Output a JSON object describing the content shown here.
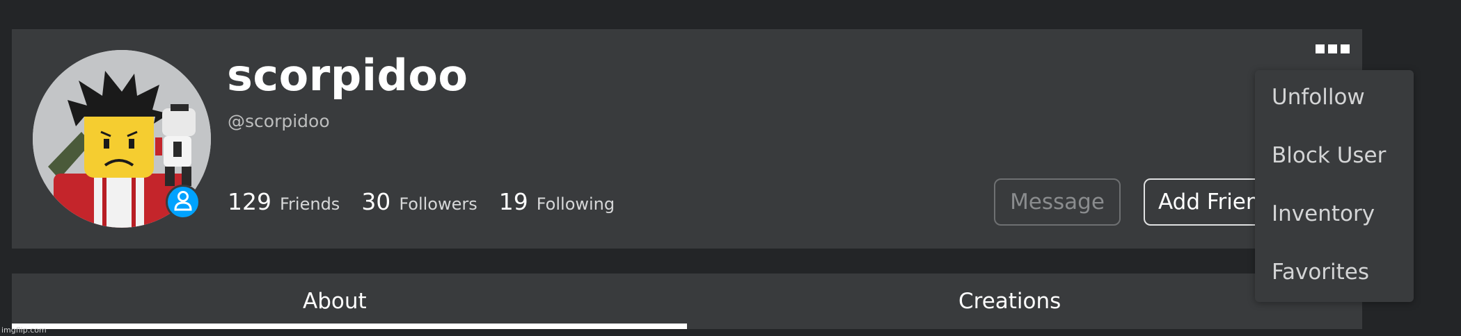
{
  "profile": {
    "display_name": "scorpidoo",
    "handle": "@scorpidoo",
    "stats": [
      {
        "value": "129",
        "label": "Friends"
      },
      {
        "value": "30",
        "label": "Followers"
      },
      {
        "value": "19",
        "label": "Following"
      }
    ],
    "presence_icon": "user-icon"
  },
  "actions": {
    "message_label": "Message",
    "add_friend_label": "Add Friend"
  },
  "menu": {
    "more_icon": "more-options-icon",
    "items": [
      "Unfollow",
      "Block User",
      "Inventory",
      "Favorites"
    ]
  },
  "tabs": [
    {
      "label": "About",
      "active": true
    },
    {
      "label": "Creations",
      "active": false
    }
  ],
  "watermark": "imgflip.com",
  "colors": {
    "background": "#232527",
    "card": "#393b3d",
    "presence": "#00a2ff"
  }
}
